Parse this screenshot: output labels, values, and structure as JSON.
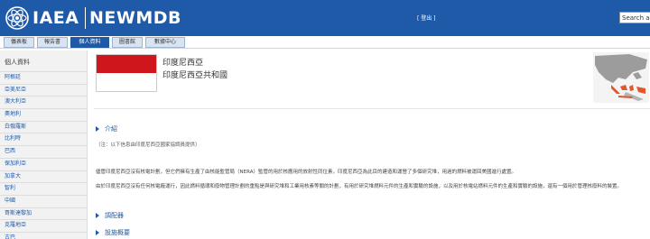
{
  "header": {
    "brand_left": "IAEA",
    "brand_right": "NEWMDB",
    "logout": "[ 登出 ]",
    "search_value": "Search a"
  },
  "nav": {
    "tabs": [
      {
        "label": "儀表板"
      },
      {
        "label": "報告書"
      },
      {
        "label": "個人資料"
      },
      {
        "label": "圖書館"
      },
      {
        "label": "數據中心"
      }
    ],
    "active_index": 2
  },
  "sidebar": {
    "title": "個人資料",
    "items": [
      {
        "label": "阿根廷"
      },
      {
        "label": "亞美尼亞"
      },
      {
        "label": "澳大利亞"
      },
      {
        "label": "奧地利"
      },
      {
        "label": "白俄羅斯"
      },
      {
        "label": "比利時"
      },
      {
        "label": "巴西"
      },
      {
        "label": "保加利亞"
      },
      {
        "label": "加拿大"
      },
      {
        "label": "智利"
      },
      {
        "label": "中國"
      },
      {
        "label": "哥斯達黎加"
      },
      {
        "label": "克羅地亞"
      },
      {
        "label": "古巴"
      }
    ]
  },
  "country": {
    "short_name": "印度尼西亞",
    "long_name": "印度尼西亞共和國",
    "flag_colors": [
      "#d0161d",
      "#ffffff"
    ]
  },
  "sections": {
    "intro_title": "介紹",
    "intro_note": "（注：以下信息由印度尼西亞國家協調員提供）",
    "para1": "儘管印度尼西亞沒有核電計劃，但它們擁有生產了由核能監管局（NERA）監管的用於核應用的放射性同位素，印度尼西亞為此目的建造和運營了多個研究堆，用過的燃料被運回美國進行處置。",
    "para2": "由於印度尼西亞沒有任何核電廠運行，因此燃料循環和廢物管理計劃的重點是與研究堆和工業用核素等關的計劃，有用於研究堆燃料元件的生產和實驗的設施，以及用於核電站燃料元件的生產和實驗的設施，還有一個用於管理核廢料的裝置。",
    "reactor_title": "調配器",
    "facility_title": "設施概要"
  },
  "colors": {
    "brand_blue": "#1f5aa8",
    "flag_red": "#d0161d",
    "map_highlight": "#e2562c"
  },
  "icons": {
    "logo": "iaea-atom-logo",
    "map": "southeast-asia-locator-map",
    "section_marker": "triangle-right-icon"
  }
}
